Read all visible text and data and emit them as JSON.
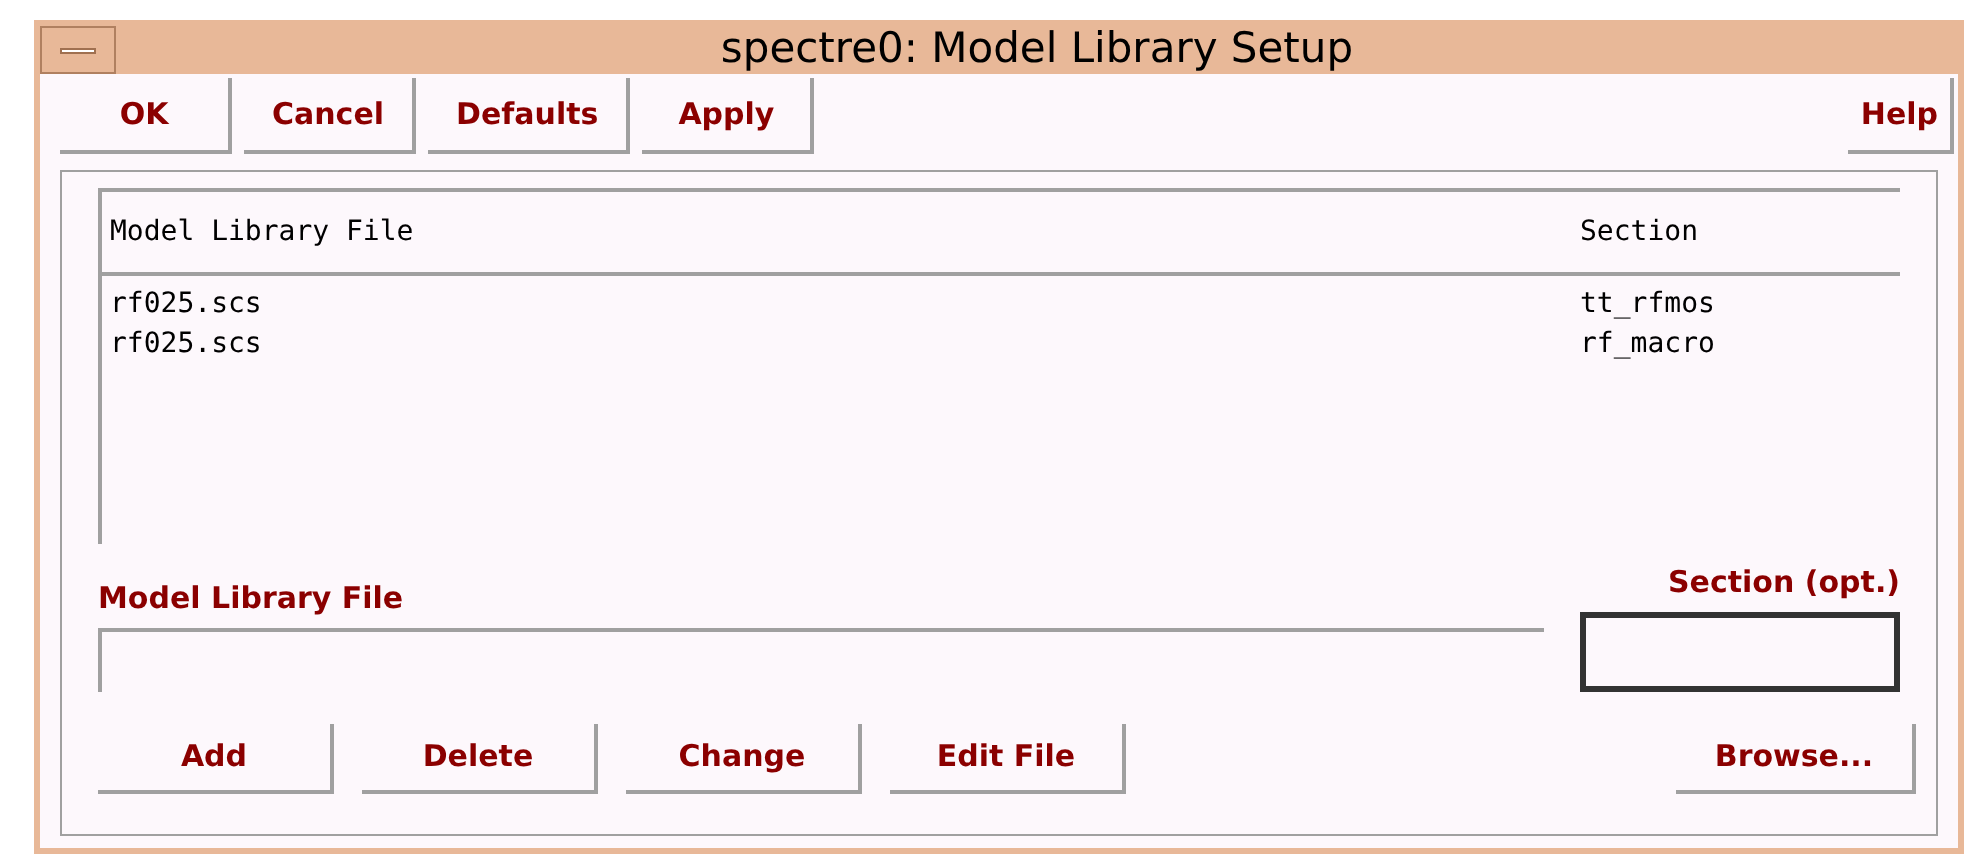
{
  "window": {
    "title": "spectre0: Model Library Setup"
  },
  "toolbar": {
    "buttons": [
      "OK",
      "Cancel",
      "Defaults",
      "Apply"
    ],
    "help": "Help"
  },
  "table": {
    "columns": [
      "Model Library File",
      "Section"
    ],
    "rows": [
      [
        "rf025.scs",
        "tt_rfmos"
      ],
      [
        "rf025.scs",
        "rf_macro"
      ]
    ]
  },
  "fields": {
    "file_label": "Model Library File",
    "section_label": "Section (opt.)"
  },
  "actions": {
    "buttons": [
      "Add",
      "Delete",
      "Change",
      "Edit File"
    ],
    "browse": "Browse..."
  }
}
